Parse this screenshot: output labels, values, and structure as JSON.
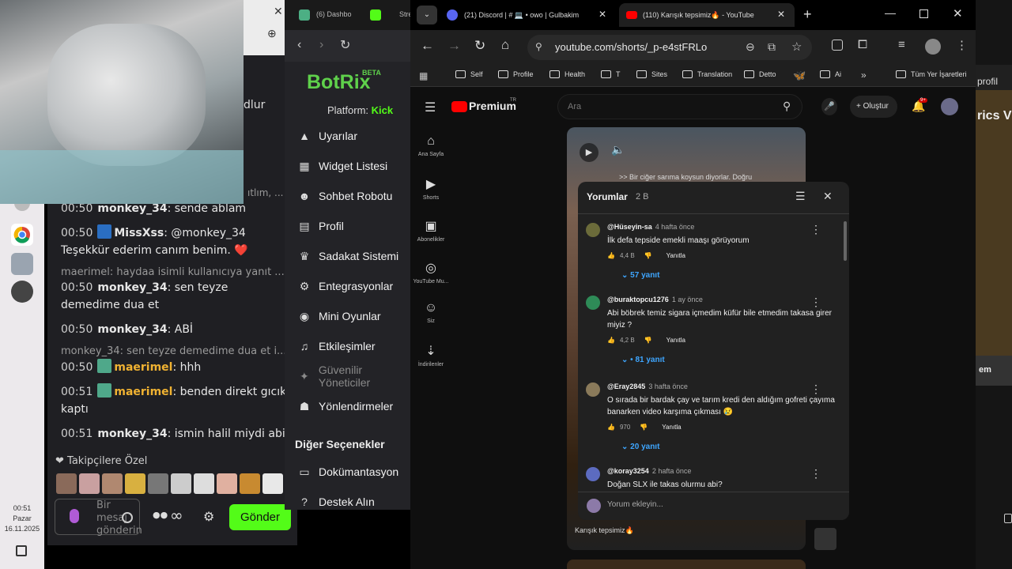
{
  "taskbar": {
    "clock_time": "00:51",
    "clock_day": "Pazar",
    "clock_date": "16.11.2025"
  },
  "chat": {
    "truncated_top": "dlur",
    "truncated_mid": "ıtlım, ...",
    "messages": [
      {
        "time": "00:50",
        "user": "monkey_34",
        "text": "sende ablam",
        "badge": false,
        "user_color": "white"
      },
      {
        "time": "00:50",
        "user": "MissXss",
        "text": "@monkey_34 Teşekkür ederim canım benim. ❤️",
        "badge": true,
        "user_color": "white"
      },
      {
        "time": "00:50",
        "user": "monkey_34",
        "text": "sen teyze demedime dua et",
        "badge": false,
        "user_color": "white"
      },
      {
        "time": "00:50",
        "user": "monkey_34",
        "text": "ABİ",
        "badge": false,
        "user_color": "white"
      },
      {
        "time": "00:50",
        "user": "maerimel",
        "text": "hhh",
        "badge": true,
        "user_color": "yellow"
      },
      {
        "time": "00:51",
        "user": "maerimel",
        "text": "benden direkt gıcık kaptı",
        "badge": true,
        "user_color": "yellow"
      },
      {
        "time": "00:51",
        "user": "monkey_34",
        "text": "ismin halil miydi abi",
        "badge": false,
        "user_color": "white"
      }
    ],
    "reply1": "maerimel: haydaa isimli kullanıcıya yanıt ...",
    "reply2": "monkey_34: sen teyze demedime dua et i...",
    "followers_only": "Takipçilere Özel",
    "input_placeholder": "Bir mesaj gönderin",
    "infinity": "∞",
    "send_label": "Gönder"
  },
  "botrix": {
    "logo": "BotRix",
    "beta": "BETA",
    "platform_label": "Platform:",
    "platform_value": "Kick",
    "menu": [
      {
        "icon": "warning-icon",
        "glyph": "▲",
        "label": "Uyarılar"
      },
      {
        "icon": "widget-icon",
        "glyph": "▦",
        "label": "Widget Listesi"
      },
      {
        "icon": "robot-icon",
        "glyph": "☻",
        "label": "Sohbet Robotu"
      },
      {
        "icon": "profile-icon",
        "glyph": "▤",
        "label": "Profil"
      },
      {
        "icon": "trophy-icon",
        "glyph": "♛",
        "label": "Sadakat Sistemi"
      },
      {
        "icon": "integration-icon",
        "glyph": "⚙",
        "label": "Entegrasyonlar"
      },
      {
        "icon": "gamepad-icon",
        "glyph": "◉",
        "label": "Mini Oyunlar"
      },
      {
        "icon": "music-icon",
        "glyph": "♫",
        "label": "Etkileşimler"
      },
      {
        "icon": "shield-icon",
        "glyph": "✦",
        "label": "Güvenilir Yöneticiler"
      },
      {
        "icon": "users-icon",
        "glyph": "☗",
        "label": "Yönlendirmeler"
      }
    ],
    "other_options": "Diğer Seçenekler",
    "docs": "Dokümantasyon",
    "support": "Destek Alın",
    "tab_dashboard": "(6) Dashbo",
    "tab_stream": "Stre"
  },
  "youtube": {
    "tabs": [
      {
        "label": "(21) Discord | # 💻 • owo | Gulbakim"
      },
      {
        "label": "(110) Karışık tepsimiz🔥 - YouTube"
      }
    ],
    "url": "youtube.com/shorts/_p-e4stFRLo",
    "bookmarks": [
      "Self",
      "Profile",
      "Health",
      "T",
      "Sites",
      "Translation",
      "Detto",
      "Ai",
      "Tüm Yer İşaretleri"
    ],
    "brand": "Premium",
    "tm": "TR",
    "search_placeholder": "Ara",
    "create_label": "Oluştur",
    "notif_count": "9+",
    "sidebar": [
      {
        "icon": "home-icon",
        "glyph": "⌂",
        "label": "Ana Sayfa"
      },
      {
        "icon": "shorts-icon",
        "glyph": "▶",
        "label": "Shorts"
      },
      {
        "icon": "subscriptions-icon",
        "glyph": "▣",
        "label": "Abonelikler"
      },
      {
        "icon": "youtube-music-icon",
        "glyph": "◎",
        "label": "YouTube Mu..."
      },
      {
        "icon": "you-icon",
        "glyph": "☺",
        "label": "Siz"
      },
      {
        "icon": "download-icon",
        "glyph": "⇣",
        "label": "İndirilenler"
      }
    ],
    "video_caption": ">> Bir ciğer sarıma koysun diyorlar. Doğru",
    "video_title": "Karışık tepsimiz🔥",
    "comments": {
      "title": "Yorumlar",
      "count": "2 B",
      "items": [
        {
          "author": "@Hüseyin-sa",
          "ago": "4 hafta önce",
          "text": "İlk defa tepside emekli maaşı görüyorum",
          "likes": "4,4 B",
          "reply": "Yanıtla",
          "replies": "57 yanıt",
          "avatar_color": "#6b6b3a"
        },
        {
          "author": "@buraktopcu1276",
          "ago": "1 ay önce",
          "text": "Abi böbrek temiz sigara içmedim küfür bile etmedim takasa girer miyiz ?",
          "likes": "4,2 B",
          "reply": "Yanıtla",
          "replies": "• 81 yanıt",
          "avatar_color": "#2e8b57"
        },
        {
          "author": "@Eray2845",
          "ago": "3 hafta önce",
          "text": "O sırada bir bardak çay ve tarım kredi den aldığım gofreti çayıma banarken video karşıma çıkması 😢",
          "likes": "970",
          "reply": "Yanıtla",
          "replies": "20 yanıt",
          "avatar_color": "#8a7a5a"
        },
        {
          "author": "@koray3254",
          "ago": "2 hafta önce",
          "text": "Doğan SLX ile takas olurmu abi?",
          "likes": "",
          "reply": "",
          "replies": "",
          "avatar_color": "#5c6bc0"
        }
      ],
      "add_placeholder": "Yorum ekleyin..."
    }
  },
  "right_edge": {
    "profil": "profil",
    "rics": "rics V",
    "em": "em"
  }
}
